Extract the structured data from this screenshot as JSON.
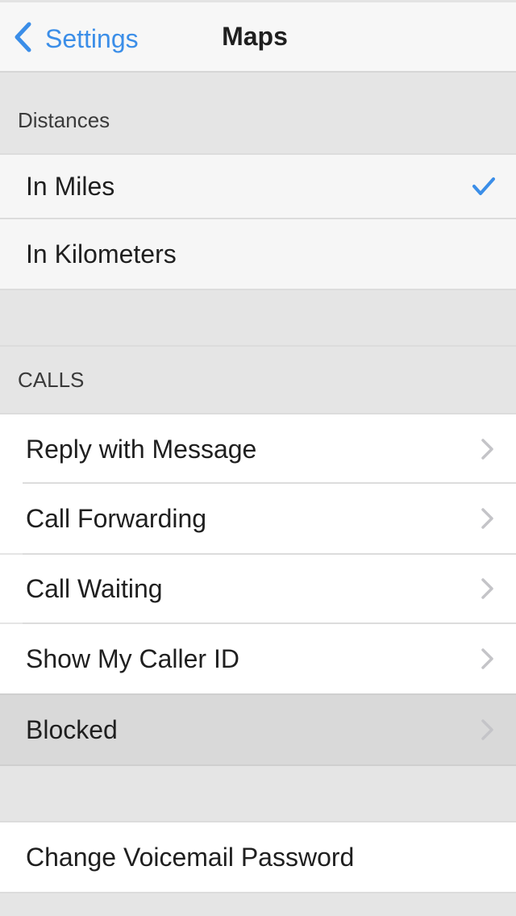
{
  "navbar": {
    "back_label": "Settings",
    "title": "Maps"
  },
  "distances": {
    "header": "Distances",
    "options": [
      {
        "label": "In Miles",
        "selected": true
      },
      {
        "label": "In Kilometers",
        "selected": false
      }
    ]
  },
  "calls": {
    "header": "CALLS",
    "items": [
      {
        "label": "Reply with Message"
      },
      {
        "label": "Call Forwarding"
      },
      {
        "label": "Call Waiting"
      },
      {
        "label": "Show My Caller ID"
      },
      {
        "label": "Blocked",
        "highlighted": true
      }
    ]
  },
  "voicemail": {
    "change_password_label": "Change Voicemail Password"
  },
  "icons": {
    "back": "chevron-left-icon",
    "check": "checkmark-icon",
    "disclosure": "chevron-right-icon"
  },
  "colors": {
    "accent": "#3b8ee8",
    "group_background": "#e5e5e5",
    "highlight": "#d9d9d9"
  }
}
